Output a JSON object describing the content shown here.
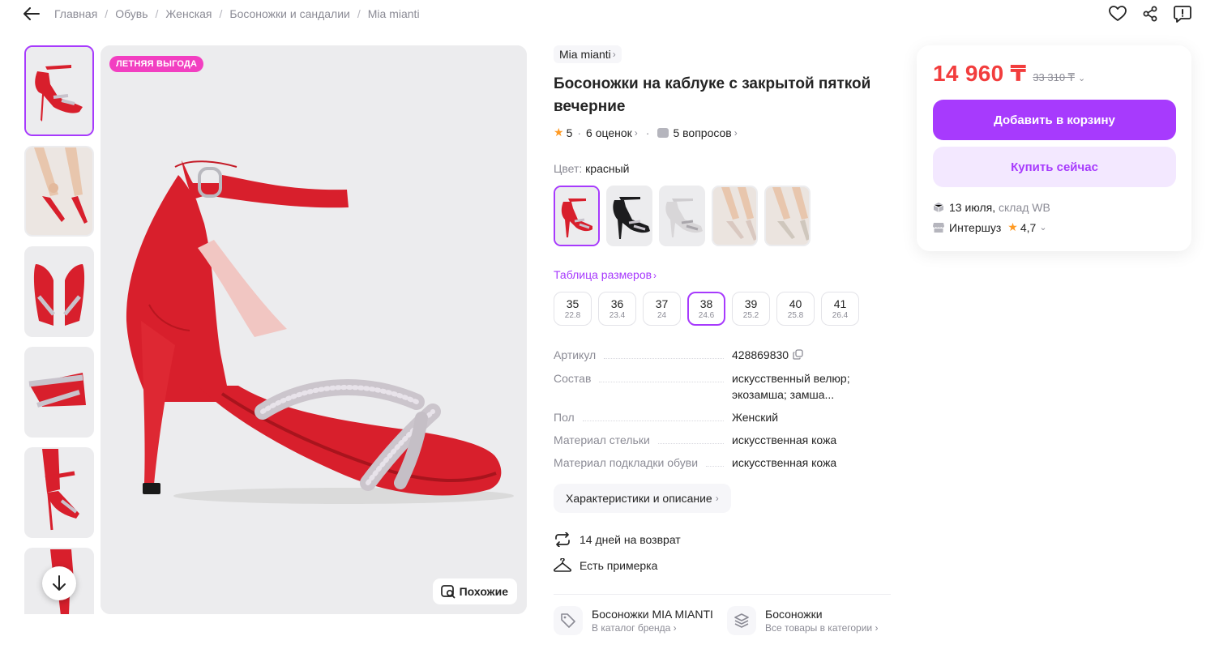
{
  "breadcrumb": [
    "Главная",
    "Обувь",
    "Женская",
    "Босоножки и сандалии",
    "Mia mianti"
  ],
  "gallery": {
    "promo_badge": "ЛЕТНЯЯ ВЫГОДА",
    "similar_label": "Похожие",
    "thumbnail_count": 6
  },
  "product": {
    "brand": "Mia mianti",
    "title": "Босоножки на каблуке с закрытой пяткой вечерние",
    "rating": "5",
    "reviews": "6 оценок",
    "questions": "5 вопросов",
    "color_label": "Цвет:",
    "color_value": "красный",
    "size_table_label": "Таблица размеров",
    "sizes": [
      {
        "size": "35",
        "length": "22.8"
      },
      {
        "size": "36",
        "length": "23.4"
      },
      {
        "size": "37",
        "length": "24"
      },
      {
        "size": "38",
        "length": "24.6"
      },
      {
        "size": "39",
        "length": "25.2"
      },
      {
        "size": "40",
        "length": "25.8"
      },
      {
        "size": "41",
        "length": "26.4"
      }
    ],
    "selected_size": "38"
  },
  "specs": [
    {
      "key": "Артикул",
      "value": "428869830"
    },
    {
      "key": "Состав",
      "value": "искусственный велюр; экозамша; замша..."
    },
    {
      "key": "Пол",
      "value": "Женский"
    },
    {
      "key": "Материал стельки",
      "value": "искусственная кожа"
    },
    {
      "key": "Материал подкладки обуви",
      "value": "искусственная кожа"
    }
  ],
  "characteristics_button": "Характеристики и описание",
  "perks": {
    "return": "14 дней на возврат",
    "fitting": "Есть примерка"
  },
  "links": {
    "brand_title": "Босоножки MIA MIANTI",
    "brand_sub": "В каталог бренда",
    "category_title": "Босоножки",
    "category_sub": "Все товары в категории"
  },
  "price": {
    "current": "14 960 ₸",
    "old": "33 310 ₸",
    "add_to_cart": "Добавить в корзину",
    "buy_now": "Купить сейчас",
    "delivery_date": "13 июля,",
    "delivery_source": "склад WB",
    "seller": "Интершуз",
    "seller_rating": "4,7"
  },
  "colors": {
    "accent": "#a73afd",
    "price": "#f23d3d",
    "promo": "#f23fc1",
    "shoe_red": "#d81f2c"
  }
}
